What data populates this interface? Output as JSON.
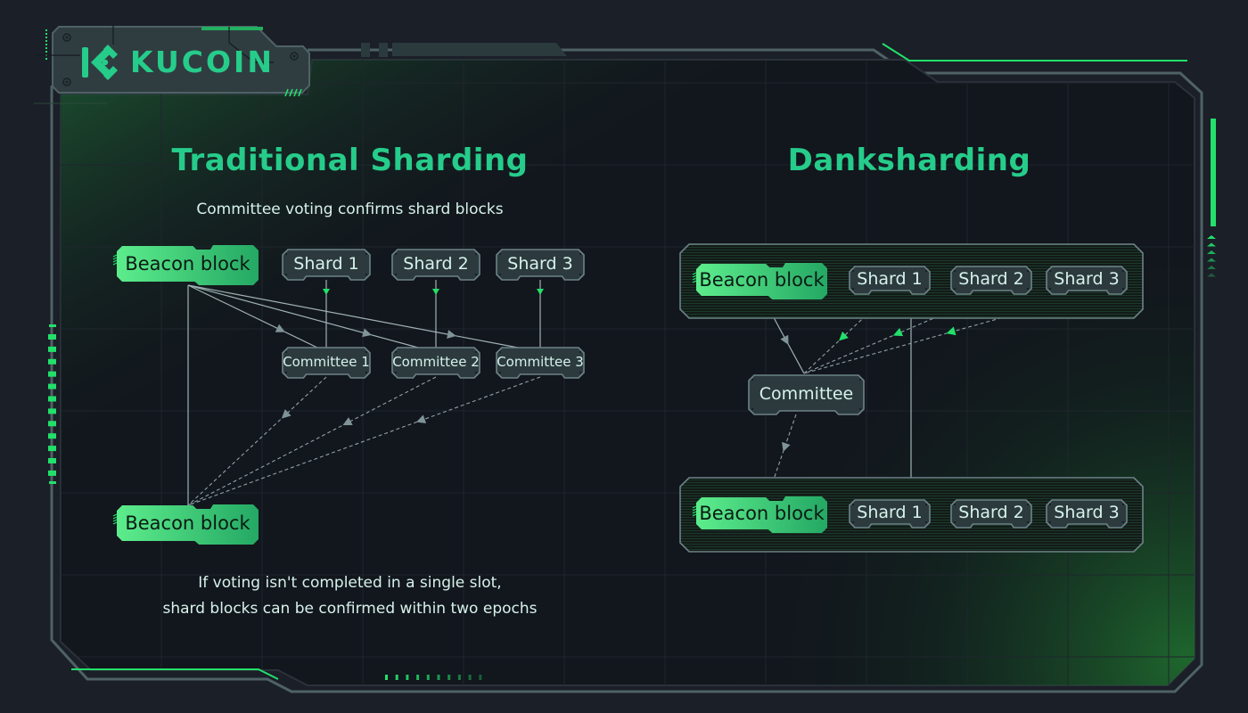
{
  "brand": {
    "name": "KUCOIN",
    "logo_icon": "kucoin-logo-icon",
    "accent_color": "#26cc8a",
    "highlight_color": "#22e06a",
    "background_color": "#1b1f28",
    "panel_color": "#12161d",
    "node_color": "#2c3a3e",
    "border_color": "#4e6265"
  },
  "left": {
    "title": "Traditional Sharding",
    "subtitle": "Committee voting confirms shard blocks",
    "footnote_line1": "If voting isn't completed in a single slot,",
    "footnote_line2": "shard blocks can be confirmed within two epochs",
    "beacon_top": "Beacon block",
    "beacon_bottom": "Beacon block",
    "shards": [
      "Shard 1",
      "Shard 2",
      "Shard 3"
    ],
    "committees": [
      "Committee 1",
      "Committee 2",
      "Committee 3"
    ]
  },
  "right": {
    "title": "Danksharding",
    "top_row": {
      "beacon": "Beacon block",
      "shards": [
        "Shard 1",
        "Shard 2",
        "Shard 3"
      ]
    },
    "committee": "Committee",
    "bottom_row": {
      "beacon": "Beacon block",
      "shards": [
        "Shard 1",
        "Shard 2",
        "Shard 3"
      ]
    }
  },
  "edges": {
    "left": [
      {
        "from": "beacon_top",
        "to": "committee_1",
        "style": "solid"
      },
      {
        "from": "beacon_top",
        "to": "committee_2",
        "style": "solid"
      },
      {
        "from": "beacon_top",
        "to": "committee_3",
        "style": "solid"
      },
      {
        "from": "beacon_top",
        "to": "beacon_bottom",
        "style": "solid"
      },
      {
        "from": "shard_1",
        "to": "committee_1",
        "style": "solid"
      },
      {
        "from": "shard_2",
        "to": "committee_2",
        "style": "solid"
      },
      {
        "from": "shard_3",
        "to": "committee_3",
        "style": "solid"
      },
      {
        "from": "committee_1",
        "to": "beacon_bottom",
        "style": "dashed"
      },
      {
        "from": "committee_2",
        "to": "beacon_bottom",
        "style": "dashed"
      },
      {
        "from": "committee_3",
        "to": "beacon_bottom",
        "style": "dashed"
      }
    ],
    "right": [
      {
        "from": "top_beacon",
        "to": "committee",
        "style": "solid"
      },
      {
        "from": "top_shard_1",
        "to": "committee",
        "style": "dashed"
      },
      {
        "from": "top_shard_2",
        "to": "committee",
        "style": "dashed"
      },
      {
        "from": "top_shard_3",
        "to": "committee",
        "style": "dashed"
      },
      {
        "from": "committee",
        "to": "bottom_beacon",
        "style": "dashed"
      },
      {
        "from": "top_row",
        "to": "bottom_row",
        "style": "solid"
      }
    ]
  }
}
